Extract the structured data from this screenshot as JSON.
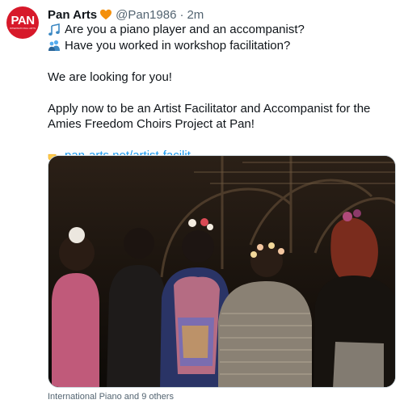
{
  "tweet": {
    "avatar_text": "PAN",
    "avatar_subtext": "INTERNATIONAL ARTS",
    "author_name": "Pan Arts",
    "author_badge_icon": "orange-heart-icon",
    "handle": "@Pan1986",
    "separator": "·",
    "timestamp": "2m",
    "lines": [
      {
        "icon": "music-notes-icon",
        "text": "Are you a piano player and an accompanist?"
      },
      {
        "icon": "people-icon",
        "text": "Have you worked in workshop facilitation?"
      }
    ],
    "paragraph_1": "We are looking for you!",
    "paragraph_2": "Apply now to be an Artist Facilitator and Accompanist for the Amies Freedom Choirs Project at Pan!",
    "link_icon": "pointing-hand-icon",
    "link_text": "pan-arts.net/artist-facilit…",
    "media_description_icon": "photo",
    "tagged_caption": "International Piano and 9 others",
    "colors": {
      "brand_red": "#d7192a",
      "link_blue": "#1d9bf0",
      "muted_gray": "#536471"
    }
  }
}
